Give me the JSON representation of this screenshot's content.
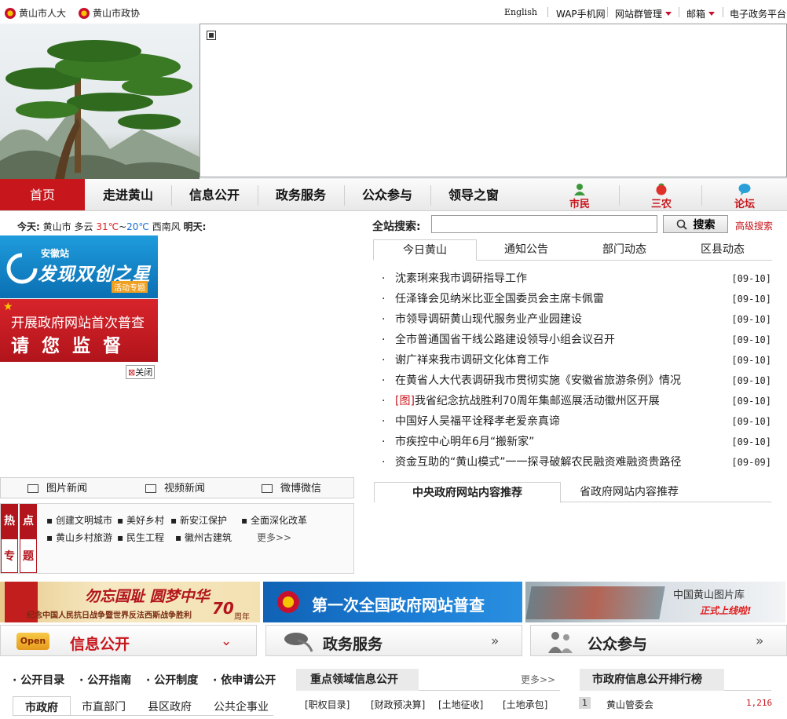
{
  "topbar": {
    "left_links": [
      "黄山市人大",
      "黄山市政协"
    ],
    "right_links": [
      "English",
      "WAP手机网",
      "网站群管理",
      "邮箱",
      "电子政务平台"
    ]
  },
  "nav": {
    "items": [
      "首页",
      "走进黄山",
      "信息公开",
      "政务服务",
      "公众参与",
      "领导之窗"
    ],
    "quick": [
      "市民",
      "三农",
      "论坛"
    ]
  },
  "weather": {
    "today_label": "今天:",
    "city": "黄山市",
    "condition": "多云",
    "temp_high": "31℃",
    "temp_sep": "~",
    "temp_low": "20℃",
    "wind": "西南风",
    "tomorrow_label": "明天:"
  },
  "search": {
    "label": "全站搜索:",
    "value": "",
    "button": "搜索",
    "advanced": "高级搜索"
  },
  "ads": {
    "ad1_small": "安徽站",
    "ad1_title": "发现双创之星",
    "ad1_tag": "活动专题",
    "ad2_line1": "开展政府网站首次普查",
    "ad2_line2": "请 您 监 督",
    "close": "关闭"
  },
  "news": {
    "tabs": [
      "今日黄山",
      "通知公告",
      "部门动态",
      "区县动态"
    ],
    "items": [
      {
        "title": "沈素琍来我市调研指导工作",
        "date": "[09-10]",
        "tag": ""
      },
      {
        "title": "任泽锋会见纳米比亚全国委员会主席卡佩雷",
        "date": "[09-10]",
        "tag": ""
      },
      {
        "title": "市领导调研黄山现代服务业产业园建设",
        "date": "[09-10]",
        "tag": ""
      },
      {
        "title": "全市普通国省干线公路建设领导小组会议召开",
        "date": "[09-10]",
        "tag": ""
      },
      {
        "title": "谢广祥来我市调研文化体育工作",
        "date": "[09-10]",
        "tag": ""
      },
      {
        "title": "在黄省人大代表调研我市贯彻实施《安徽省旅游条例》情况",
        "date": "[09-10]",
        "tag": ""
      },
      {
        "title": "我省纪念抗战胜利70周年集邮巡展活动徽州区开展",
        "date": "[09-10]",
        "tag": "[图]"
      },
      {
        "title": "中国好人吴福平诠释孝老爱亲真谛",
        "date": "[09-10]",
        "tag": ""
      },
      {
        "title": "市疾控中心明年6月“搬新家”",
        "date": "[09-10]",
        "tag": ""
      },
      {
        "title": "资金互助的“黄山模式”一一探寻破解农民融资难融资贵路径",
        "date": "[09-09]",
        "tag": ""
      }
    ]
  },
  "recommend_tabs": [
    "中央政府网站内容推荐",
    "省政府网站内容推荐"
  ],
  "media_tabs": [
    "图片新闻",
    "视频新闻",
    "微博微信"
  ],
  "hot": {
    "labels": [
      "热",
      "点",
      "专",
      "题"
    ],
    "row1": [
      "创建文明城市",
      "美好乡村",
      "新安江保护",
      "全面深化改革"
    ],
    "row2": [
      "黄山乡村旅游",
      "民生工程",
      "徽州古建筑"
    ],
    "more": "更多>>"
  },
  "feature_banners": {
    "fb1_title": "勿忘国耻 圆梦中华",
    "fb1_sub": "纪念中国人民抗日战争暨世界反法西斯战争胜利",
    "fb1_years": "70",
    "fb1_years_suffix": "周年",
    "fb2_title": "第一次全国政府网站普查",
    "fb3_title": "中国黄山图片库",
    "fb3_sub": "正式上线啦!"
  },
  "sections": {
    "info": {
      "badge": "Open",
      "title": "信息公开"
    },
    "service": {
      "title": "政务服务"
    },
    "public": {
      "title": "公众参与"
    }
  },
  "info_links": [
    "公开目录",
    "公开指南",
    "公开制度",
    "依申请公开"
  ],
  "info_tabs": [
    "市政府",
    "市直部门",
    "县区政府",
    "公共企事业"
  ],
  "key_info": {
    "title": "重点领域信息公开",
    "more": "更多>>",
    "items": [
      "[职权目录]",
      "[财政预决算]",
      "[土地征收]",
      "[土地承包]"
    ]
  },
  "ranking": {
    "title": "市政府信息公开排行榜",
    "first": {
      "rank": "1",
      "name": "黄山管委会",
      "count": "1,216"
    }
  },
  "colors": {
    "brand_red": "#c8161d"
  }
}
